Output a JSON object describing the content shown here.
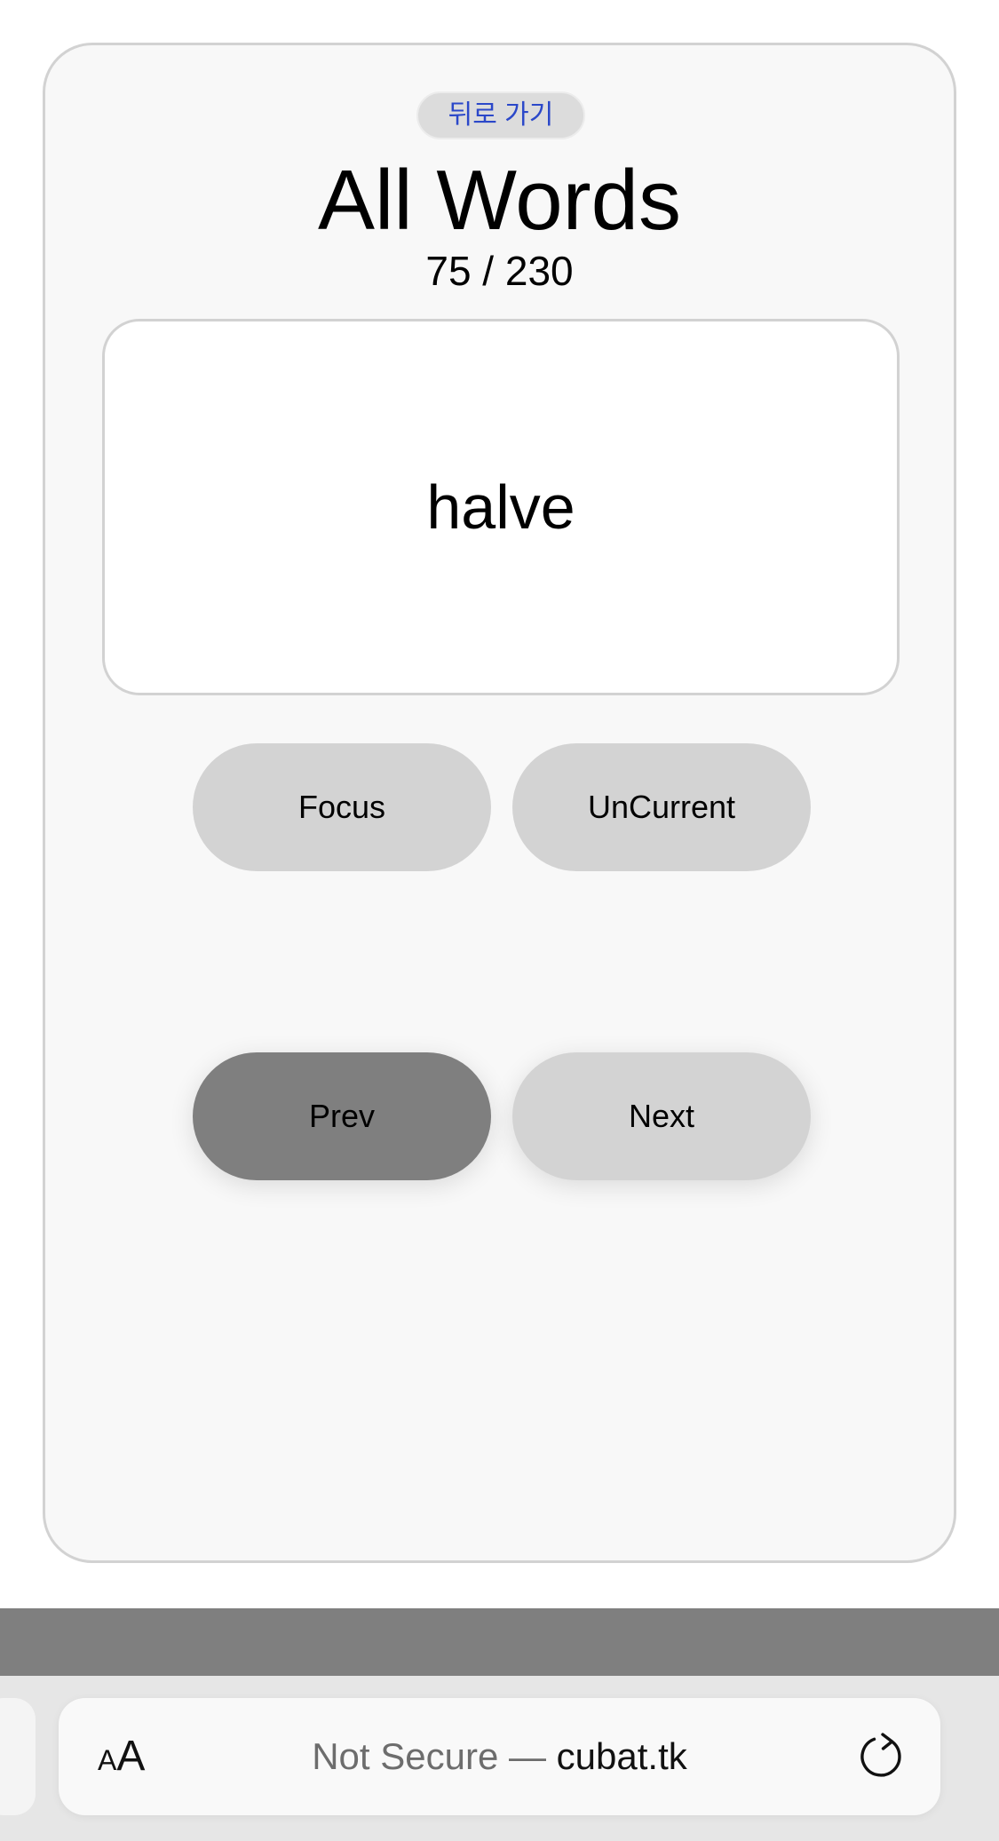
{
  "back_button_label": "뒤로 가기",
  "title": "All Words",
  "progress": {
    "text": "75 / 230",
    "current": 75,
    "total": 230
  },
  "card": {
    "word": "halve"
  },
  "actions": {
    "focus_label": "Focus",
    "uncurrent_label": "UnCurrent"
  },
  "navigation": {
    "prev_label": "Prev",
    "next_label": "Next"
  },
  "browser": {
    "text_size_small": "A",
    "text_size_large": "A",
    "security_text": "Not Secure — ",
    "domain": "cubat.tk",
    "reload_icon": "reload-icon"
  },
  "colors": {
    "back_button_text": "#2b48c9",
    "pressed_button": "#7f7f7f",
    "button": "#d3d3d3"
  }
}
